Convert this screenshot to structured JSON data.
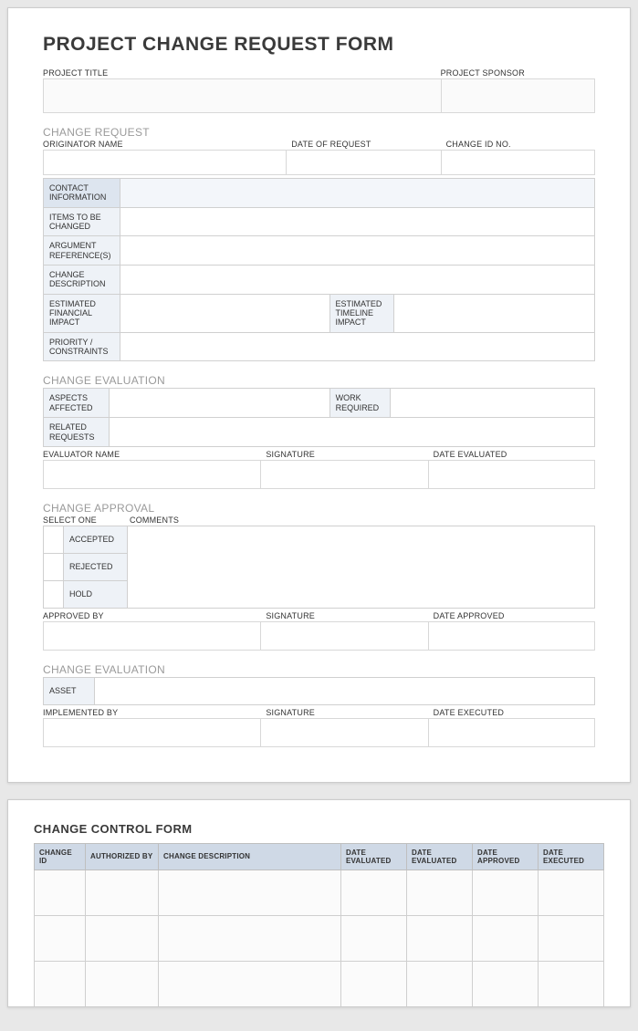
{
  "form_title": "PROJECT CHANGE REQUEST FORM",
  "header": {
    "project_title_label": "PROJECT TITLE",
    "project_sponsor_label": "PROJECT SPONSOR"
  },
  "change_request": {
    "section": "CHANGE REQUEST",
    "originator_label": "ORIGINATOR NAME",
    "date_label": "DATE OF REQUEST",
    "change_id_label": "CHANGE ID NO.",
    "contact_info": "CONTACT INFORMATION",
    "items_changed": "ITEMS TO BE CHANGED",
    "argument_ref": "ARGUMENT REFERENCE(S)",
    "change_desc": "CHANGE DESCRIPTION",
    "est_financial": "ESTIMATED FINANCIAL IMPACT",
    "est_timeline": "ESTIMATED TIMELINE IMPACT",
    "priority": "PRIORITY / CONSTRAINTS"
  },
  "change_eval": {
    "section": "CHANGE EVALUATION",
    "aspects": "ASPECTS AFFECTED",
    "work_req": "WORK REQUIRED",
    "related": "RELATED REQUESTS",
    "evaluator_label": "EVALUATOR NAME",
    "signature_label": "SIGNATURE",
    "date_label": "DATE EVALUATED"
  },
  "change_approval": {
    "section": "CHANGE APPROVAL",
    "select_one": "SELECT ONE",
    "comments": "COMMENTS",
    "accepted": "ACCEPTED",
    "rejected": "REJECTED",
    "hold": "HOLD",
    "approved_by": "APPROVED BY",
    "signature_label": "SIGNATURE",
    "date_label": "DATE APPROVED"
  },
  "change_eval2": {
    "section": "CHANGE EVALUATION",
    "asset": "ASSET",
    "implemented_by": "IMPLEMENTED BY",
    "signature_label": "SIGNATURE",
    "date_label": "DATE EXECUTED"
  },
  "ccf": {
    "title": "CHANGE CONTROL FORM",
    "h1": "CHANGE ID",
    "h2": "AUTHORIZED BY",
    "h3": "CHANGE DESCRIPTION",
    "h4": "DATE EVALUATED",
    "h5": "DATE EVALUATED",
    "h6": "DATE APPROVED",
    "h7": "DATE EXECUTED"
  }
}
